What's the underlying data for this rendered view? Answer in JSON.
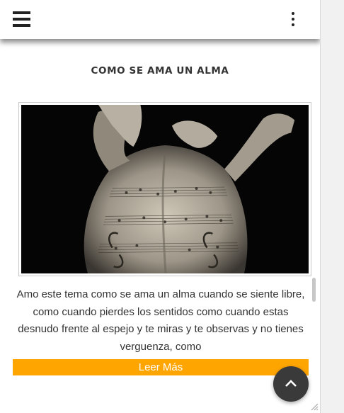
{
  "header": {
    "menu_icon": "hamburger-menu-icon",
    "more_icon": "vertical-ellipsis-icon"
  },
  "post": {
    "title": "COMO SE AMA UN ALMA",
    "image_alt": "Espalda con partituras",
    "excerpt": "Amo este tema como se ama un alma cuando se siente libre, como cuando pierdes los sentidos como cuando estas desnudo frente al espejo y te miras y te observas y no tienes verguenza, como",
    "read_more_label": "Leer Más"
  },
  "scroll_top": {
    "icon": "chevron-up-icon"
  },
  "colors": {
    "accent": "#ffa500",
    "fab": "#3a3a3a",
    "text": "#333333"
  }
}
